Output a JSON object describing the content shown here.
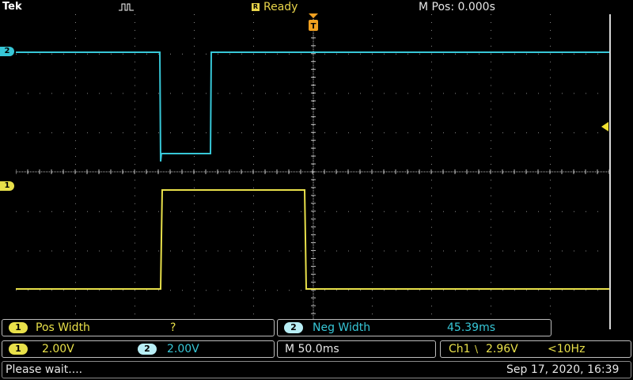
{
  "header": {
    "brand": "Tek",
    "status": "Ready",
    "m_pos": "M Pos: 0.000s"
  },
  "channels": {
    "ch1": {
      "label": "1",
      "color": "#e8e04a"
    },
    "ch2": {
      "label": "2",
      "color": "#37c7d7"
    }
  },
  "trigger_marker": {
    "label": "T",
    "color": "#f0a020"
  },
  "measurements": [
    {
      "channel": "1",
      "name": "Pos Width",
      "value": "?"
    },
    {
      "channel": "2",
      "name": "Neg Width",
      "value": "45.39ms"
    }
  ],
  "scales": {
    "ch1_scale": "2.00V",
    "ch2_scale": "2.00V",
    "timebase": "M 50.0ms",
    "trigger_source": "Ch1",
    "trigger_slope": "\\",
    "trigger_level": "2.96V",
    "trigger_freq": "<10Hz"
  },
  "footer": {
    "message": "Please wait....",
    "datetime": "Sep 17, 2020, 16:39"
  }
}
